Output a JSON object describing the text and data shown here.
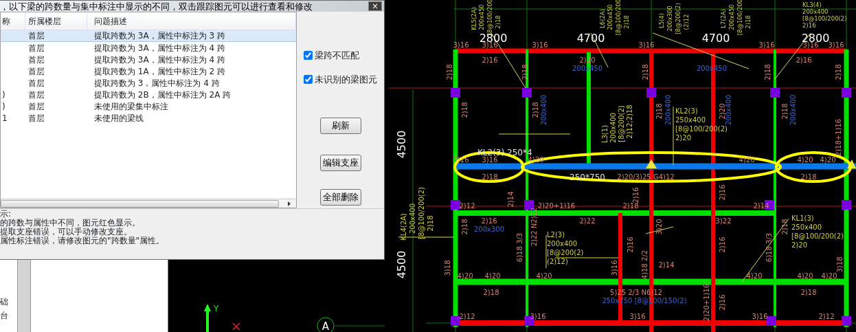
{
  "dialog": {
    "title": "，以下梁的跨数量与集中标注中显示的不同，双击跟踪图元可以进行查看和修改",
    "close": "×",
    "table": {
      "columns": [
        "称",
        "所属楼层",
        "问题描述"
      ],
      "rows": [
        {
          "floor": "首层",
          "description": "提取跨数为 3A，属性中标注为 3 跨",
          "selected": true
        },
        {
          "floor": "首层",
          "description": "提取跨数为 3A，属性中标注为 4 跨",
          "selected": false
        },
        {
          "floor": "首层",
          "description": "提取跨数为 3A，属性中标注为 4 跨",
          "selected": false
        },
        {
          "floor": "首层",
          "description": "提取跨数为 1A，属性中标注为 2 跨",
          "selected": false
        },
        {
          "floor": "首层",
          "description": "提取跨数为 3，属性中标注为 4 跨",
          "selected": false
        },
        {
          "name": ")",
          "floor": "首层",
          "description": "提取跨数为 2B，属性中标注为 2A 跨",
          "selected": false
        },
        {
          "name": ")",
          "floor": "首层",
          "description": "未使用的梁集中标注",
          "selected": false
        },
        {
          "name": "1",
          "floor": "首层",
          "description": "未使用的梁线",
          "selected": false
        }
      ]
    },
    "filters": [
      {
        "label": "梁跨不匹配",
        "checked": true
      },
      {
        "label": "未识别的梁图元",
        "checked": true
      }
    ],
    "buttons": [
      "刷新",
      "编辑支座",
      "全部删除"
    ],
    "hints": [
      "示:",
      "的跨数与属性中不同，图元红色显示。",
      "提取支座错误，可以手动修改支座。",
      "属性标注错误，请修改图元的\"跨数量\"属性。"
    ]
  },
  "side_panel": {
    "items": [
      "础",
      "台"
    ]
  },
  "drawing": {
    "axis_label": "Y",
    "grid_bubble": "A",
    "labels": [
      {
        "text": "KL5(2A)",
        "kind": "beam"
      },
      {
        "text": "200x450",
        "kind": "beam"
      },
      {
        "text": "[8@100/200",
        "kind": "beam"
      },
      {
        "text": "2)18",
        "kind": "beam"
      },
      {
        "text": "L6(2A)",
        "kind": "beam"
      },
      {
        "text": "200x450",
        "kind": "beam"
      },
      {
        "text": "[8@100/200",
        "kind": "beam"
      },
      {
        "text": "2)18",
        "kind": "beam"
      },
      {
        "text": "L5(4)",
        "kind": "beam"
      },
      {
        "text": "200x300",
        "kind": "beam"
      },
      {
        "text": "[8@200(2)",
        "kind": "beam"
      },
      {
        "text": "(2)12",
        "kind": "beam"
      },
      {
        "text": "L7(2A)",
        "kind": "beam"
      },
      {
        "text": "200x450",
        "kind": "beam"
      },
      {
        "text": "[8@100/200",
        "kind": "beam"
      },
      {
        "text": "2)18",
        "kind": "beam"
      },
      {
        "text": "KL3(4)",
        "kind": "beam"
      },
      {
        "text": "200x400",
        "kind": "beam"
      },
      {
        "text": "[8@100/200(2)",
        "kind": "beam"
      },
      {
        "text": "2)16",
        "kind": "beam"
      },
      {
        "text": "2800",
        "kind": "dimension"
      },
      {
        "text": "4700",
        "kind": "dimension"
      },
      {
        "text": "4700",
        "kind": "dimension"
      },
      {
        "text": "2800",
        "kind": "dimension"
      },
      {
        "text": "4500",
        "kind": "dimension"
      },
      {
        "text": "4500",
        "kind": "dimension"
      },
      {
        "text": "3)16",
        "kind": "rebar"
      },
      {
        "text": "3)16",
        "kind": "rebar"
      },
      {
        "text": "3)16",
        "kind": "rebar"
      },
      {
        "text": "3)16",
        "kind": "rebar"
      },
      {
        "text": "3)16",
        "kind": "rebar"
      },
      {
        "text": "3)16",
        "kind": "rebar"
      },
      {
        "text": "3)16",
        "kind": "rebar"
      },
      {
        "text": "2)16",
        "kind": "rebar"
      },
      {
        "text": "2)20",
        "kind": "rebar"
      },
      {
        "text": "2)16",
        "kind": "rebar"
      },
      {
        "text": "200x450",
        "kind": "section"
      },
      {
        "text": "200x450",
        "kind": "section"
      },
      {
        "text": "2)18",
        "kind": "rebar"
      },
      {
        "text": "2)18",
        "kind": "rebar"
      },
      {
        "text": "2)18",
        "kind": "rebar"
      },
      {
        "text": "2)18",
        "kind": "rebar"
      },
      {
        "text": "2)18",
        "kind": "rebar"
      },
      {
        "text": "2)18",
        "kind": "rebar"
      },
      {
        "text": "2)18",
        "kind": "rebar"
      },
      {
        "text": "200x400",
        "kind": "section"
      },
      {
        "text": "2)18",
        "kind": "rebar"
      },
      {
        "text": "200x400",
        "kind": "section"
      },
      {
        "text": "2)20",
        "kind": "rebar"
      },
      {
        "text": "200x400",
        "kind": "section"
      },
      {
        "text": "2)18",
        "kind": "rebar"
      },
      {
        "text": "200x400",
        "kind": "section"
      },
      {
        "text": "L3(1)",
        "kind": "beam"
      },
      {
        "text": "200x400",
        "kind": "beam"
      },
      {
        "text": "[8@200(2)",
        "kind": "beam"
      },
      {
        "text": "2)12;2)18",
        "kind": "beam"
      },
      {
        "text": "KL2(3)",
        "kind": "beam"
      },
      {
        "text": "250x400",
        "kind": "beam"
      },
      {
        "text": "[8@100/200(2)",
        "kind": "beam"
      },
      {
        "text": "2)20",
        "kind": "beam"
      },
      {
        "text": "2)18+1)16",
        "kind": "rebar"
      },
      {
        "text": "KL2(3) 250*4",
        "kind": "name"
      },
      {
        "text": "3)16",
        "kind": "rebar"
      },
      {
        "text": "3)16",
        "kind": "rebar"
      },
      {
        "text": "4)20",
        "kind": "rebar"
      },
      {
        "text": "4)20",
        "kind": "rebar"
      },
      {
        "text": "4)20",
        "kind": "rebar"
      },
      {
        "text": "4)20",
        "kind": "rebar"
      },
      {
        "text": "2)18",
        "kind": "rebar"
      },
      {
        "text": "250*750",
        "kind": "name"
      },
      {
        "text": "2)20/3)25 G4)12",
        "kind": "rebar"
      },
      {
        "text": "2)18",
        "kind": "rebar"
      },
      {
        "text": "2)14",
        "kind": "rebar"
      },
      {
        "text": "2)16",
        "kind": "rebar"
      },
      {
        "text": "2)16",
        "kind": "rebar"
      },
      {
        "text": "2)12",
        "kind": "rebar"
      },
      {
        "text": "2)20+1)16",
        "kind": "rebar"
      },
      {
        "text": "2)18",
        "kind": "rebar"
      },
      {
        "text": "2)14",
        "kind": "rebar"
      },
      {
        "text": "KL4(2A)",
        "kind": "beam"
      },
      {
        "text": "200x400",
        "kind": "beam"
      },
      {
        "text": "[8@100/200(2)",
        "kind": "beam"
      },
      {
        "text": "2)18",
        "kind": "beam"
      },
      {
        "text": "2)16",
        "kind": "rebar"
      },
      {
        "text": "200x300",
        "kind": "section"
      },
      {
        "text": "2)22",
        "kind": "rebar"
      },
      {
        "text": "3)22",
        "kind": "rebar"
      },
      {
        "text": "2)18",
        "kind": "rebar"
      },
      {
        "text": "2)22 N2)12",
        "kind": "rebar"
      },
      {
        "text": "3)20",
        "kind": "rebar"
      },
      {
        "text": "2)18",
        "kind": "rebar"
      },
      {
        "text": "KL1(3)",
        "kind": "beam"
      },
      {
        "text": "250x400",
        "kind": "beam"
      },
      {
        "text": "[8@100/200(2)",
        "kind": "beam"
      },
      {
        "text": "2)20",
        "kind": "beam"
      },
      {
        "text": "L2(3)",
        "kind": "beam"
      },
      {
        "text": "200x400",
        "kind": "beam"
      },
      {
        "text": "[8@200(2)",
        "kind": "beam"
      },
      {
        "text": "(2)12)",
        "kind": "beam"
      },
      {
        "text": "6)18 3/3",
        "kind": "rebar"
      },
      {
        "text": "2)16",
        "kind": "rebar"
      },
      {
        "text": "2)16",
        "kind": "rebar"
      },
      {
        "text": "6)18 3/3",
        "kind": "rebar"
      },
      {
        "text": "3)18",
        "kind": "rebar"
      },
      {
        "text": "3)18",
        "kind": "rebar"
      },
      {
        "text": "3)16",
        "kind": "rebar"
      },
      {
        "text": "4)18 2/2",
        "kind": "rebar"
      },
      {
        "text": "2)14",
        "kind": "rebar"
      },
      {
        "text": "4)20",
        "kind": "rebar"
      },
      {
        "text": "4)20",
        "kind": "rebar"
      },
      {
        "text": "4)20",
        "kind": "rebar"
      },
      {
        "text": "4)20",
        "kind": "rebar"
      },
      {
        "text": "4)20",
        "kind": "rebar"
      },
      {
        "text": "4)20",
        "kind": "rebar"
      },
      {
        "text": "2)18",
        "kind": "rebar"
      },
      {
        "text": "5)25 2/3 N6)12",
        "kind": "rebar"
      },
      {
        "text": "2)18",
        "kind": "rebar"
      },
      {
        "text": "250x750 [8@100/150(2)",
        "kind": "section"
      },
      {
        "text": "2)20+1)16",
        "kind": "rebar"
      },
      {
        "text": "2)16",
        "kind": "rebar"
      },
      {
        "text": "2)12",
        "kind": "rebar"
      },
      {
        "text": "3)16",
        "kind": "rebar"
      },
      {
        "text": "3)16",
        "kind": "rebar"
      },
      {
        "text": "3)16",
        "kind": "rebar"
      },
      {
        "text": "2)12",
        "kind": "rebar"
      }
    ]
  }
}
